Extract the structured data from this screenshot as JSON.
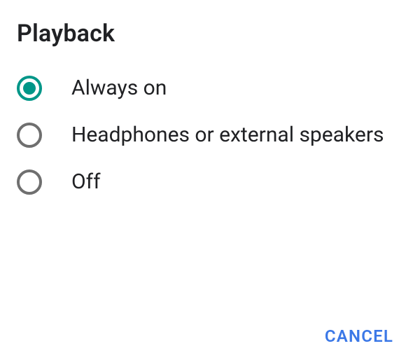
{
  "title": "Playback",
  "options": [
    {
      "label": "Always on",
      "selected": true
    },
    {
      "label": "Headphones or external speakers",
      "selected": false
    },
    {
      "label": "Off",
      "selected": false
    }
  ],
  "actions": {
    "cancel": "CANCEL"
  }
}
